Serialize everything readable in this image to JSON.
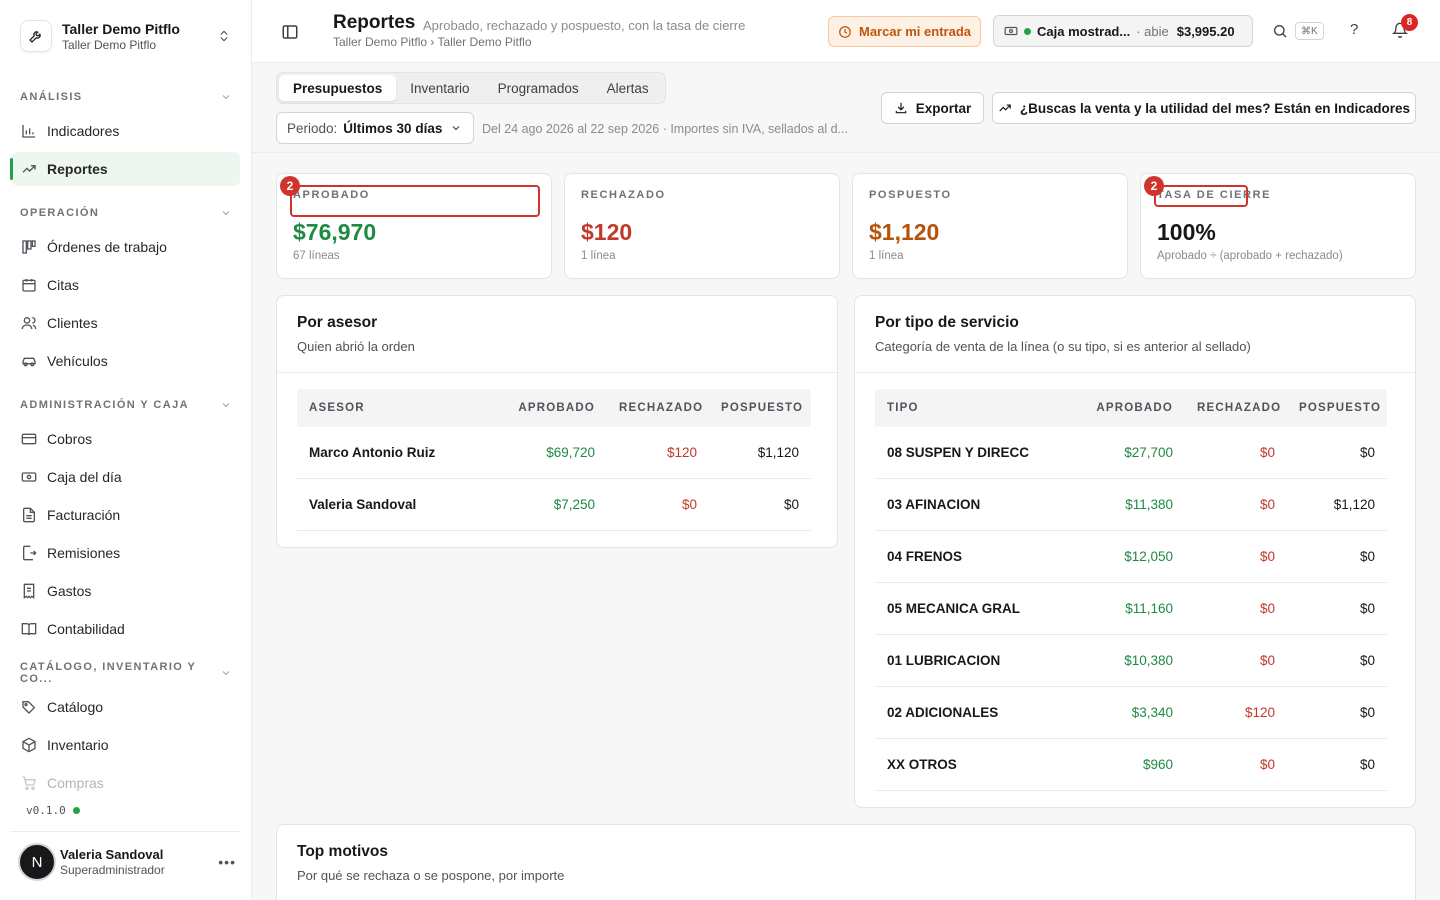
{
  "workspace": {
    "name": "Taller Demo Pitflo",
    "sub": "Taller Demo Pitflo"
  },
  "sidebar": {
    "sections": [
      {
        "title": "Análisis"
      },
      {
        "title": "Operación"
      },
      {
        "title": "Administración y caja"
      },
      {
        "title": "Catálogo, inventario y co..."
      }
    ],
    "items": [
      {
        "label": "Indicadores",
        "icon": "bar-chart-icon"
      },
      {
        "label": "Reportes",
        "icon": "trending-up-icon",
        "active": true
      },
      {
        "label": "Órdenes de trabajo",
        "icon": "kanban-icon"
      },
      {
        "label": "Citas",
        "icon": "calendar-icon"
      },
      {
        "label": "Clientes",
        "icon": "users-icon"
      },
      {
        "label": "Vehículos",
        "icon": "car-icon"
      },
      {
        "label": "Cobros",
        "icon": "credit-card-icon"
      },
      {
        "label": "Caja del día",
        "icon": "cash-icon"
      },
      {
        "label": "Facturación",
        "icon": "file-text-icon"
      },
      {
        "label": "Remisiones",
        "icon": "file-export-icon"
      },
      {
        "label": "Gastos",
        "icon": "receipt-icon"
      },
      {
        "label": "Contabilidad",
        "icon": "book-icon"
      },
      {
        "label": "Catálogo",
        "icon": "tags-icon"
      },
      {
        "label": "Inventario",
        "icon": "box-icon"
      },
      {
        "label": "Compras",
        "icon": "cart-icon"
      }
    ],
    "version": "v0.1.0",
    "user": {
      "initial": "N",
      "name": "Valeria Sandoval",
      "role": "Superadministrador"
    }
  },
  "header": {
    "title": "Reportes",
    "description": "Aprobado, rechazado y pospuesto, con la tasa de cierre",
    "breadcrumb": "Taller Demo Pitflo › Taller Demo Pitflo",
    "clockin_label": "Marcar mi entrada",
    "caja_name": "Caja mostrad...",
    "caja_state": "· abie",
    "caja_amount": "$3,995.20",
    "shortcut": "⌘K",
    "help": "?",
    "notifications": "8"
  },
  "toolbar": {
    "tabs": [
      "Presupuestos",
      "Inventario",
      "Programados",
      "Alertas"
    ],
    "period_label": "Periodo:",
    "period_value": "Últimos 30 días",
    "period_note": "Del 24 ago 2026 al 22 sep 2026 · Importes sin IVA, sellados al d...",
    "export_label": "Exportar",
    "indicators_label": "¿Buscas la venta y la utilidad del mes? Están en Indicadores"
  },
  "kpis": [
    {
      "label": "Aprobado",
      "value": "$76,970",
      "sub": "67 líneas",
      "color": "#1f8a43",
      "marker": "2"
    },
    {
      "label": "Rechazado",
      "value": "$120",
      "sub": "1 línea",
      "color": "#c0392b"
    },
    {
      "label": "Pospuesto",
      "value": "$1,120",
      "sub": "1 línea",
      "color": "#b45309"
    },
    {
      "label": "Tasa de cierre",
      "value": "100%",
      "sub": "Aprobado ÷ (aprobado + rechazado)",
      "color": "#18181b",
      "marker": "2"
    }
  ],
  "por_asesor": {
    "title": "Por asesor",
    "subtitle": "Quien abrió la orden",
    "headers": [
      "Asesor",
      "Aprobado",
      "Rechazado",
      "Pospuesto"
    ],
    "rows": [
      [
        "Marco Antonio Ruiz",
        "$69,720",
        "$120",
        "$1,120"
      ],
      [
        "Valeria Sandoval",
        "$7,250",
        "$0",
        "$0"
      ]
    ]
  },
  "por_tipo": {
    "title": "Por tipo de servicio",
    "subtitle": "Categoría de venta de la línea (o su tipo, si es anterior al sellado)",
    "headers": [
      "Tipo",
      "Aprobado",
      "Rechazado",
      "Pospuesto"
    ],
    "rows": [
      [
        "08 SUSPEN Y DIRECC",
        "$27,700",
        "$0",
        "$0"
      ],
      [
        "03 AFINACION",
        "$11,380",
        "$0",
        "$1,120"
      ],
      [
        "04 FRENOS",
        "$12,050",
        "$0",
        "$0"
      ],
      [
        "05 MECANICA GRAL",
        "$11,160",
        "$0",
        "$0"
      ],
      [
        "01 LUBRICACION",
        "$10,380",
        "$0",
        "$0"
      ],
      [
        "02 ADICIONALES",
        "$3,340",
        "$120",
        "$0"
      ],
      [
        "XX OTROS",
        "$960",
        "$0",
        "$0"
      ]
    ]
  },
  "top_motivos": {
    "title": "Top motivos",
    "subtitle": "Por qué se rechaza o se pospone, por importe"
  }
}
